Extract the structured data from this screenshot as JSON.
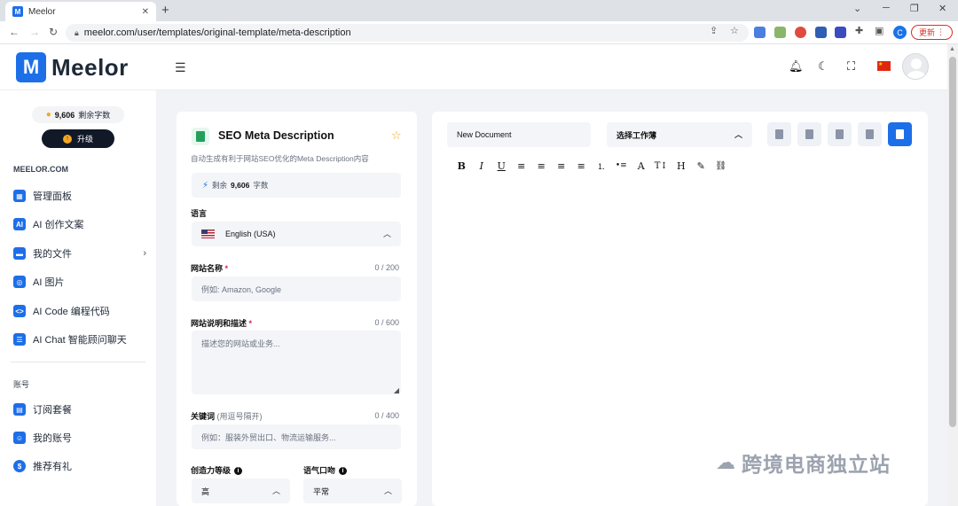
{
  "browser": {
    "tab_title": "Meelor",
    "tab_favicon": "M",
    "tab_close": "✕",
    "new_tab": "+",
    "window_controls": [
      "⌄",
      "─",
      "❐",
      "✕"
    ],
    "url": "meelor.com/user/templates/original-template/meta-description",
    "update_label": "更新",
    "profile_initial": "C"
  },
  "header": {
    "brand": "Meelor",
    "logo_letter": "M"
  },
  "sidebar": {
    "credits_value": "9,606",
    "credits_label": "剩余字数",
    "upgrade_label": "升级",
    "section_main": "MEELOR.COM",
    "items": [
      {
        "label": "管理面板",
        "icon": "dashboard-icon"
      },
      {
        "label": "AI 创作文案",
        "icon": "ai-write-icon"
      },
      {
        "label": "我的文件",
        "icon": "folder-icon"
      },
      {
        "label": "AI 图片",
        "icon": "image-icon"
      },
      {
        "label": "AI Code 编程代码",
        "icon": "code-icon"
      },
      {
        "label": "AI Chat 智能顾问聊天",
        "icon": "chat-icon"
      }
    ],
    "section_account": "账号",
    "account_items": [
      {
        "label": "订阅套餐",
        "icon": "subscription-icon"
      },
      {
        "label": "我的账号",
        "icon": "account-icon"
      },
      {
        "label": "推荐有礼",
        "icon": "referral-icon"
      }
    ]
  },
  "form": {
    "title": "SEO Meta Description",
    "description": "自动生成有利于网站SEO优化的Meta Description内容",
    "remaining_prefix": "剩余",
    "remaining_value": "9,606",
    "remaining_suffix": "字数",
    "language_label": "语言",
    "language_value": "English (USA)",
    "site_name_label": "网站名称",
    "site_name_count": "0 / 200",
    "site_name_placeholder": "例如:  Amazon, Google",
    "site_desc_label": "网站说明和描述",
    "site_desc_count": "0 / 600",
    "site_desc_placeholder": "描述您的网站或业务...",
    "keywords_label": "关键词",
    "keywords_sub": "(用逗号隔开)",
    "keywords_count": "0 / 400",
    "keywords_placeholder": "例如：服装外贸出口、物流运输服务...",
    "creativity_label": "创造力等级",
    "creativity_value": "高",
    "tone_label": "语气口吻",
    "tone_value": "平常"
  },
  "editor": {
    "document_name": "New Document",
    "workbook_label": "选择工作薄",
    "format_buttons": [
      "B",
      "I",
      "U",
      "≡",
      "≡",
      "≡",
      "≡",
      "⒈",
      "•≡",
      "A",
      "T↕",
      "H",
      "✎",
      "⛓"
    ]
  },
  "watermark": "跨境电商独立站"
}
